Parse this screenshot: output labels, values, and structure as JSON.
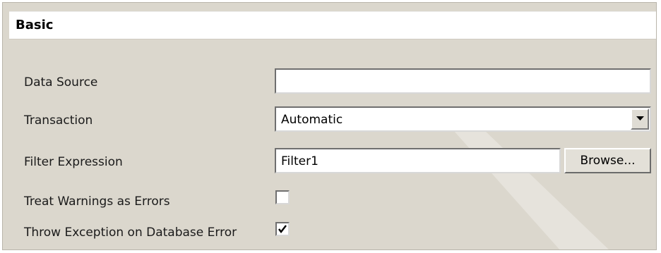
{
  "section": {
    "title": "Basic"
  },
  "fields": {
    "data_source": {
      "label": "Data Source",
      "value": ""
    },
    "transaction": {
      "label": "Transaction",
      "value": "Automatic"
    },
    "filter_expression": {
      "label": "Filter Expression",
      "value": "Filter1",
      "browse_label": "Browse..."
    },
    "treat_warnings": {
      "label": "Treat Warnings as Errors",
      "checked": false
    },
    "throw_exception": {
      "label": "Throw Exception on Database Error",
      "checked": true
    }
  },
  "icons": {
    "dropdown": "chevron-down-icon",
    "check": "checkmark-icon"
  },
  "colors": {
    "panel_bg": "#dbd7cd",
    "header_bg": "#ffffff"
  }
}
